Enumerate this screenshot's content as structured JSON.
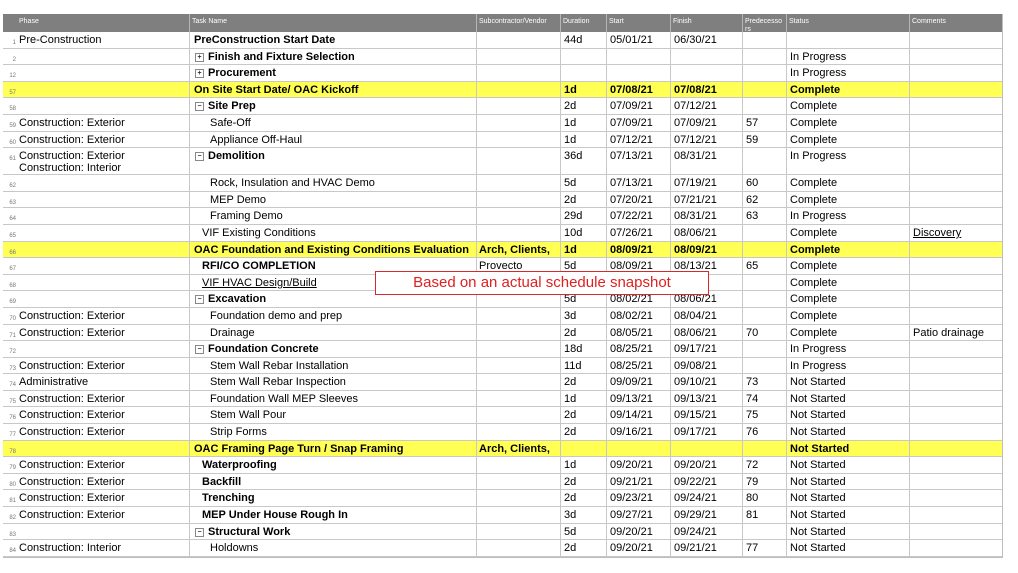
{
  "headers": [
    "Phase",
    "Task Name",
    "Subcontractor/Vendor",
    "Duration",
    "Start",
    "Finish",
    "Predecesso rs",
    "Status",
    "Comments"
  ],
  "rows": [
    {
      "id": "1",
      "phase": "Pre-Construction",
      "task": "PreConstruction Start Date",
      "vendor": "",
      "duration": "44d",
      "start": "05/01/21",
      "finish": "06/30/21",
      "pred": "",
      "status": "",
      "comments": ""
    },
    {
      "id": "2",
      "phase": "",
      "task": "Finish and Fixture Selection",
      "vendor": "",
      "duration": "",
      "start": "",
      "finish": "",
      "pred": "",
      "status": "In Progress",
      "comments": ""
    },
    {
      "id": "12",
      "phase": "",
      "task": "Procurement",
      "vendor": "",
      "duration": "",
      "start": "",
      "finish": "",
      "pred": "",
      "status": "In Progress",
      "comments": ""
    },
    {
      "id": "57",
      "phase": "",
      "task": "On Site Start Date/ OAC Kickoff",
      "vendor": "",
      "duration": "1d",
      "start": "07/08/21",
      "finish": "07/08/21",
      "pred": "",
      "status": "Complete",
      "comments": ""
    },
    {
      "id": "58",
      "phase": "",
      "task": "Site Prep",
      "vendor": "",
      "duration": "2d",
      "start": "07/09/21",
      "finish": "07/12/21",
      "pred": "",
      "status": "Complete",
      "comments": ""
    },
    {
      "id": "59",
      "phase": "Construction: Exterior",
      "task": "Safe-Off",
      "vendor": "",
      "duration": "1d",
      "start": "07/09/21",
      "finish": "07/09/21",
      "pred": "57",
      "status": "Complete",
      "comments": ""
    },
    {
      "id": "60",
      "phase": "Construction: Exterior",
      "task": "Appliance Off-Haul",
      "vendor": "",
      "duration": "1d",
      "start": "07/12/21",
      "finish": "07/12/21",
      "pred": "59",
      "status": "Complete",
      "comments": ""
    },
    {
      "id": "61",
      "phase": "Construction: Exterior",
      "phase2": "Construction: Interior",
      "task": "Demolition",
      "vendor": "",
      "duration": "36d",
      "start": "07/13/21",
      "finish": "08/31/21",
      "pred": "",
      "status": "In Progress",
      "comments": ""
    },
    {
      "id": "62",
      "phase": "",
      "task": "Rock, Insulation and HVAC Demo",
      "vendor": "",
      "duration": "5d",
      "start": "07/13/21",
      "finish": "07/19/21",
      "pred": "60",
      "status": "Complete",
      "comments": ""
    },
    {
      "id": "63",
      "phase": "",
      "task": "MEP Demo",
      "vendor": "",
      "duration": "2d",
      "start": "07/20/21",
      "finish": "07/21/21",
      "pred": "62",
      "status": "Complete",
      "comments": ""
    },
    {
      "id": "64",
      "phase": "",
      "task": "Framing Demo",
      "vendor": "",
      "duration": "29d",
      "start": "07/22/21",
      "finish": "08/31/21",
      "pred": "63",
      "status": "In Progress",
      "comments": ""
    },
    {
      "id": "65",
      "phase": "",
      "task": "VIF Existing Conditions",
      "vendor": "",
      "duration": "10d",
      "start": "07/26/21",
      "finish": "08/06/21",
      "pred": "",
      "status": "Complete",
      "comments": "Discovery"
    },
    {
      "id": "66",
      "phase": "",
      "task": "OAC Foundation and Existing Conditions Evaluation",
      "vendor": "Arch, Clients,",
      "duration": "1d",
      "start": "08/09/21",
      "finish": "08/09/21",
      "pred": "",
      "status": "Complete",
      "comments": ""
    },
    {
      "id": "67",
      "phase": "",
      "task": "RFI/CO COMPLETION",
      "vendor": "Provecto",
      "duration": "5d",
      "start": "08/09/21",
      "finish": "08/13/21",
      "pred": "65",
      "status": "Complete",
      "comments": ""
    },
    {
      "id": "68",
      "phase": "",
      "task": "VIF HVAC Design/Build",
      "vendor": "",
      "duration": "",
      "start": "",
      "finish": "",
      "pred": "",
      "status": "Complete",
      "comments": ""
    },
    {
      "id": "69",
      "phase": "",
      "task": "Excavation",
      "vendor": "",
      "duration": "5d",
      "start": "08/02/21",
      "finish": "08/06/21",
      "pred": "",
      "status": "Complete",
      "comments": ""
    },
    {
      "id": "70",
      "phase": "Construction: Exterior",
      "task": "Foundation demo and prep",
      "vendor": "",
      "duration": "3d",
      "start": "08/02/21",
      "finish": "08/04/21",
      "pred": "",
      "status": "Complete",
      "comments": ""
    },
    {
      "id": "71",
      "phase": "Construction: Exterior",
      "task": "Drainage",
      "vendor": "",
      "duration": "2d",
      "start": "08/05/21",
      "finish": "08/06/21",
      "pred": "70",
      "status": "Complete",
      "comments": "Patio drainage"
    },
    {
      "id": "72",
      "phase": "",
      "task": "Foundation Concrete",
      "vendor": "",
      "duration": "18d",
      "start": "08/25/21",
      "finish": "09/17/21",
      "pred": "",
      "status": "In Progress",
      "comments": ""
    },
    {
      "id": "73",
      "phase": "Construction: Exterior",
      "task": "Stem Wall Rebar Installation",
      "vendor": "",
      "duration": "11d",
      "start": "08/25/21",
      "finish": "09/08/21",
      "pred": "",
      "status": "In Progress",
      "comments": ""
    },
    {
      "id": "74",
      "phase": "Administrative",
      "task": "Stem Wall Rebar Inspection",
      "vendor": "",
      "duration": "2d",
      "start": "09/09/21",
      "finish": "09/10/21",
      "pred": "73",
      "status": "Not Started",
      "comments": ""
    },
    {
      "id": "75",
      "phase": "Construction: Exterior",
      "task": "Foundation Wall MEP Sleeves",
      "vendor": "",
      "duration": "1d",
      "start": "09/13/21",
      "finish": "09/13/21",
      "pred": "74",
      "status": "Not Started",
      "comments": ""
    },
    {
      "id": "76",
      "phase": "Construction: Exterior",
      "task": "Stem Wall Pour",
      "vendor": "",
      "duration": "2d",
      "start": "09/14/21",
      "finish": "09/15/21",
      "pred": "75",
      "status": "Not Started",
      "comments": ""
    },
    {
      "id": "77",
      "phase": "Construction: Exterior",
      "task": "Strip Forms",
      "vendor": "",
      "duration": "2d",
      "start": "09/16/21",
      "finish": "09/17/21",
      "pred": "76",
      "status": "Not Started",
      "comments": ""
    },
    {
      "id": "78",
      "phase": "",
      "task": "OAC Framing Page Turn / Snap Framing",
      "vendor": "Arch, Clients,",
      "duration": "",
      "start": "",
      "finish": "",
      "pred": "",
      "status": "Not Started",
      "comments": ""
    },
    {
      "id": "79",
      "phase": "Construction: Exterior",
      "task": "Waterproofing",
      "vendor": "",
      "duration": "1d",
      "start": "09/20/21",
      "finish": "09/20/21",
      "pred": "72",
      "status": "Not Started",
      "comments": ""
    },
    {
      "id": "80",
      "phase": "Construction: Exterior",
      "task": "Backfill",
      "vendor": "",
      "duration": "2d",
      "start": "09/21/21",
      "finish": "09/22/21",
      "pred": "79",
      "status": "Not Started",
      "comments": ""
    },
    {
      "id": "81",
      "phase": "Construction: Exterior",
      "task": "Trenching",
      "vendor": "",
      "duration": "2d",
      "start": "09/23/21",
      "finish": "09/24/21",
      "pred": "80",
      "status": "Not Started",
      "comments": ""
    },
    {
      "id": "82",
      "phase": "Construction: Exterior",
      "task": "MEP Under House Rough In",
      "vendor": "",
      "duration": "3d",
      "start": "09/27/21",
      "finish": "09/29/21",
      "pred": "81",
      "status": "Not Started",
      "comments": ""
    },
    {
      "id": "83",
      "phase": "",
      "task": "Structural Work",
      "vendor": "",
      "duration": "5d",
      "start": "09/20/21",
      "finish": "09/24/21",
      "pred": "",
      "status": "Not Started",
      "comments": ""
    },
    {
      "id": "84",
      "phase": "Construction: Interior",
      "task": "Holdowns",
      "vendor": "",
      "duration": "2d",
      "start": "09/20/21",
      "finish": "09/21/21",
      "pred": "77",
      "status": "Not Started",
      "comments": ""
    }
  ],
  "note": "Based on an actual schedule snapshot",
  "colors": {
    "header_bg": "#7f7f7f",
    "highlight": "#ffff54",
    "note_border": "#d42a2a",
    "note_text": "#e02020"
  }
}
